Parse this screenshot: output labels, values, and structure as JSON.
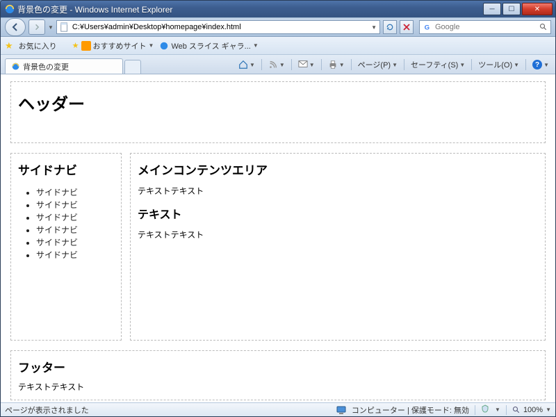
{
  "window": {
    "title": "背景色の変更 - Windows Internet Explorer"
  },
  "address": {
    "url": "C:¥Users¥admin¥Desktop¥homepage¥index.html"
  },
  "search": {
    "provider": "Google",
    "value": ""
  },
  "favbar": {
    "favorites": "お気に入り",
    "suggested": "おすすめサイト",
    "webslice": "Web スライス ギャラ..."
  },
  "tab": {
    "title": "背景色の変更"
  },
  "cmd": {
    "page": "ページ(P)",
    "safety": "セーフティ(S)",
    "tools": "ツール(O)"
  },
  "page": {
    "header": "ヘッダー",
    "sidenav_title": "サイドナビ",
    "sidenav_items": [
      "サイドナビ",
      "サイドナビ",
      "サイドナビ",
      "サイドナビ",
      "サイドナビ",
      "サイドナビ"
    ],
    "main_title": "メインコンテンツエリア",
    "main_p1": "テキストテキスト",
    "main_h3": "テキスト",
    "main_p2": "テキストテキスト",
    "footer_title": "フッター",
    "footer_p": "テキストテキスト"
  },
  "status": {
    "left": "ページが表示されました",
    "zone": "コンピューター | 保護モード: 無効",
    "zoom": "100%"
  }
}
